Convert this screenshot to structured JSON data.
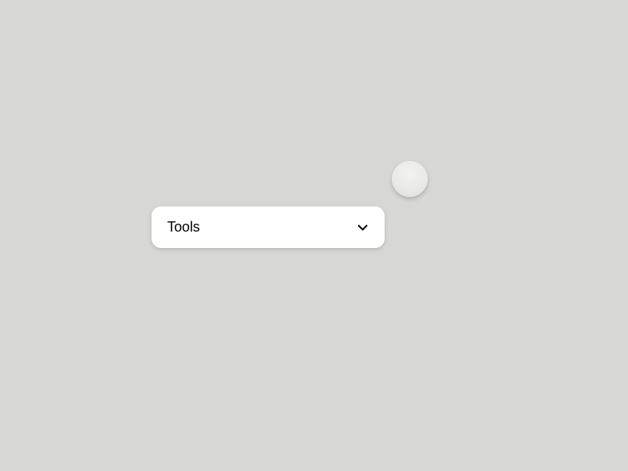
{
  "dropdown": {
    "label": "Tools"
  }
}
